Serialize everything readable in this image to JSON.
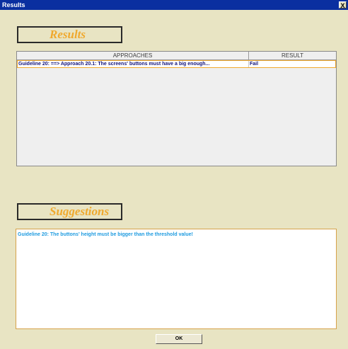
{
  "window": {
    "title": "Results",
    "close_label": "X"
  },
  "results": {
    "title": "Results",
    "columns": [
      "APPROACHES",
      "RESULT"
    ],
    "rows": [
      {
        "approach": "Guideline 20: ==> Approach 20.1: The screens' buttons must have a big enough...",
        "result": "Fail"
      }
    ]
  },
  "suggestions": {
    "title": "Suggestions",
    "items": [
      "Guideline 20: The buttons' height must be bigger than the threshold value!"
    ]
  },
  "buttons": {
    "ok_label": "OK"
  },
  "colors": {
    "window_bg": "#e8e4c3",
    "titlebar": "#0a2fa0",
    "section_title": "#f0a92e",
    "row_text": "#12127a",
    "suggestion_text": "#1e9be0"
  }
}
